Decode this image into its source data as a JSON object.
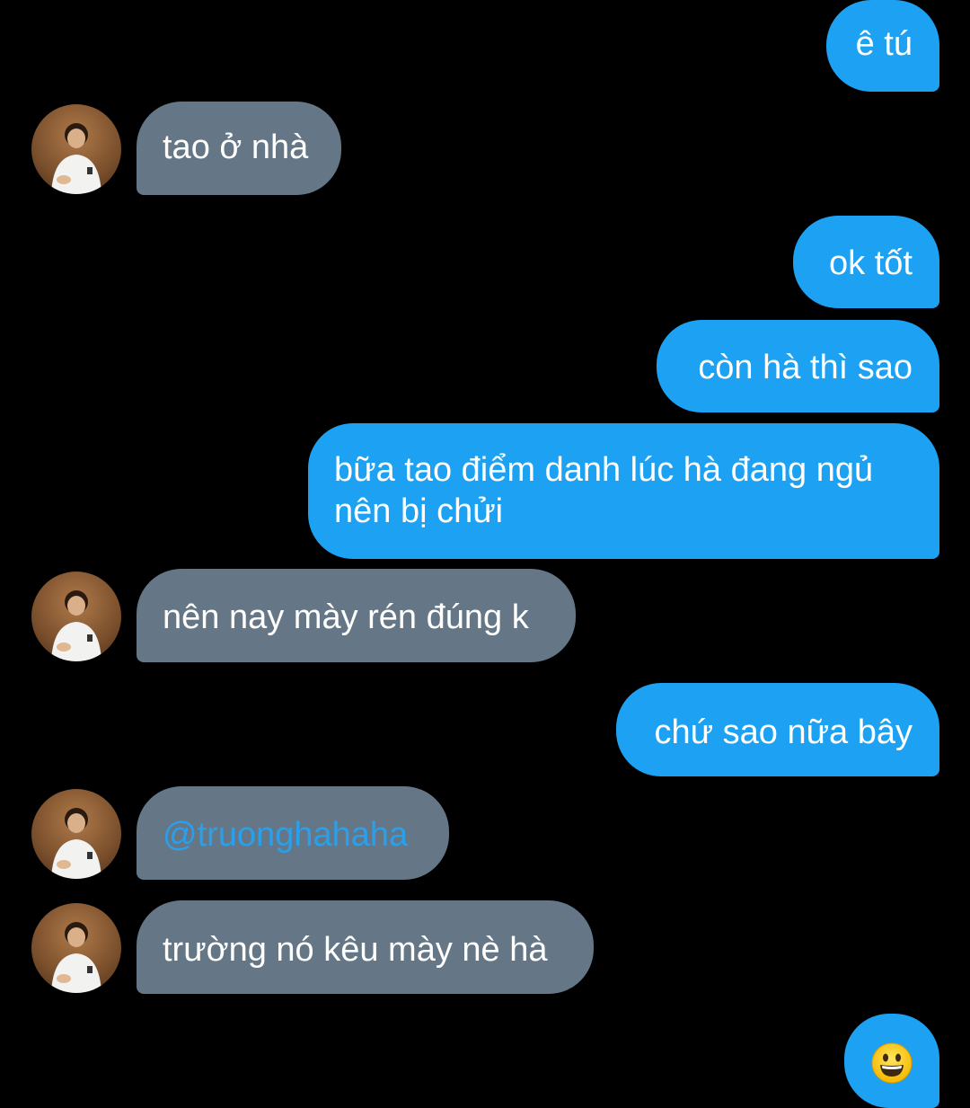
{
  "messages": [
    {
      "id": "m1",
      "side": "out",
      "text": "ê tú"
    },
    {
      "id": "m2",
      "side": "in",
      "text": "tao ở nhà"
    },
    {
      "id": "m3",
      "side": "out",
      "text": "ok tốt"
    },
    {
      "id": "m4",
      "side": "out",
      "text": "còn hà thì sao"
    },
    {
      "id": "m5",
      "side": "out",
      "text": "bữa tao điểm danh lúc hà đang ngủ nên bị chửi"
    },
    {
      "id": "m6",
      "side": "in",
      "text": "nên nay mày rén đúng k"
    },
    {
      "id": "m7",
      "side": "out",
      "text": "chứ sao nữa bây"
    },
    {
      "id": "m8",
      "side": "in",
      "text": "@truonghahaha"
    },
    {
      "id": "m9",
      "side": "in",
      "text": "trường nó kêu mày nè hà"
    },
    {
      "id": "m10",
      "side": "out",
      "emoji": "grinning-face-icon"
    }
  ],
  "colors": {
    "background": "#000000",
    "outgoing_bubble": "#1da1f2",
    "incoming_bubble": "#657786",
    "mention": "#2a9fea"
  }
}
